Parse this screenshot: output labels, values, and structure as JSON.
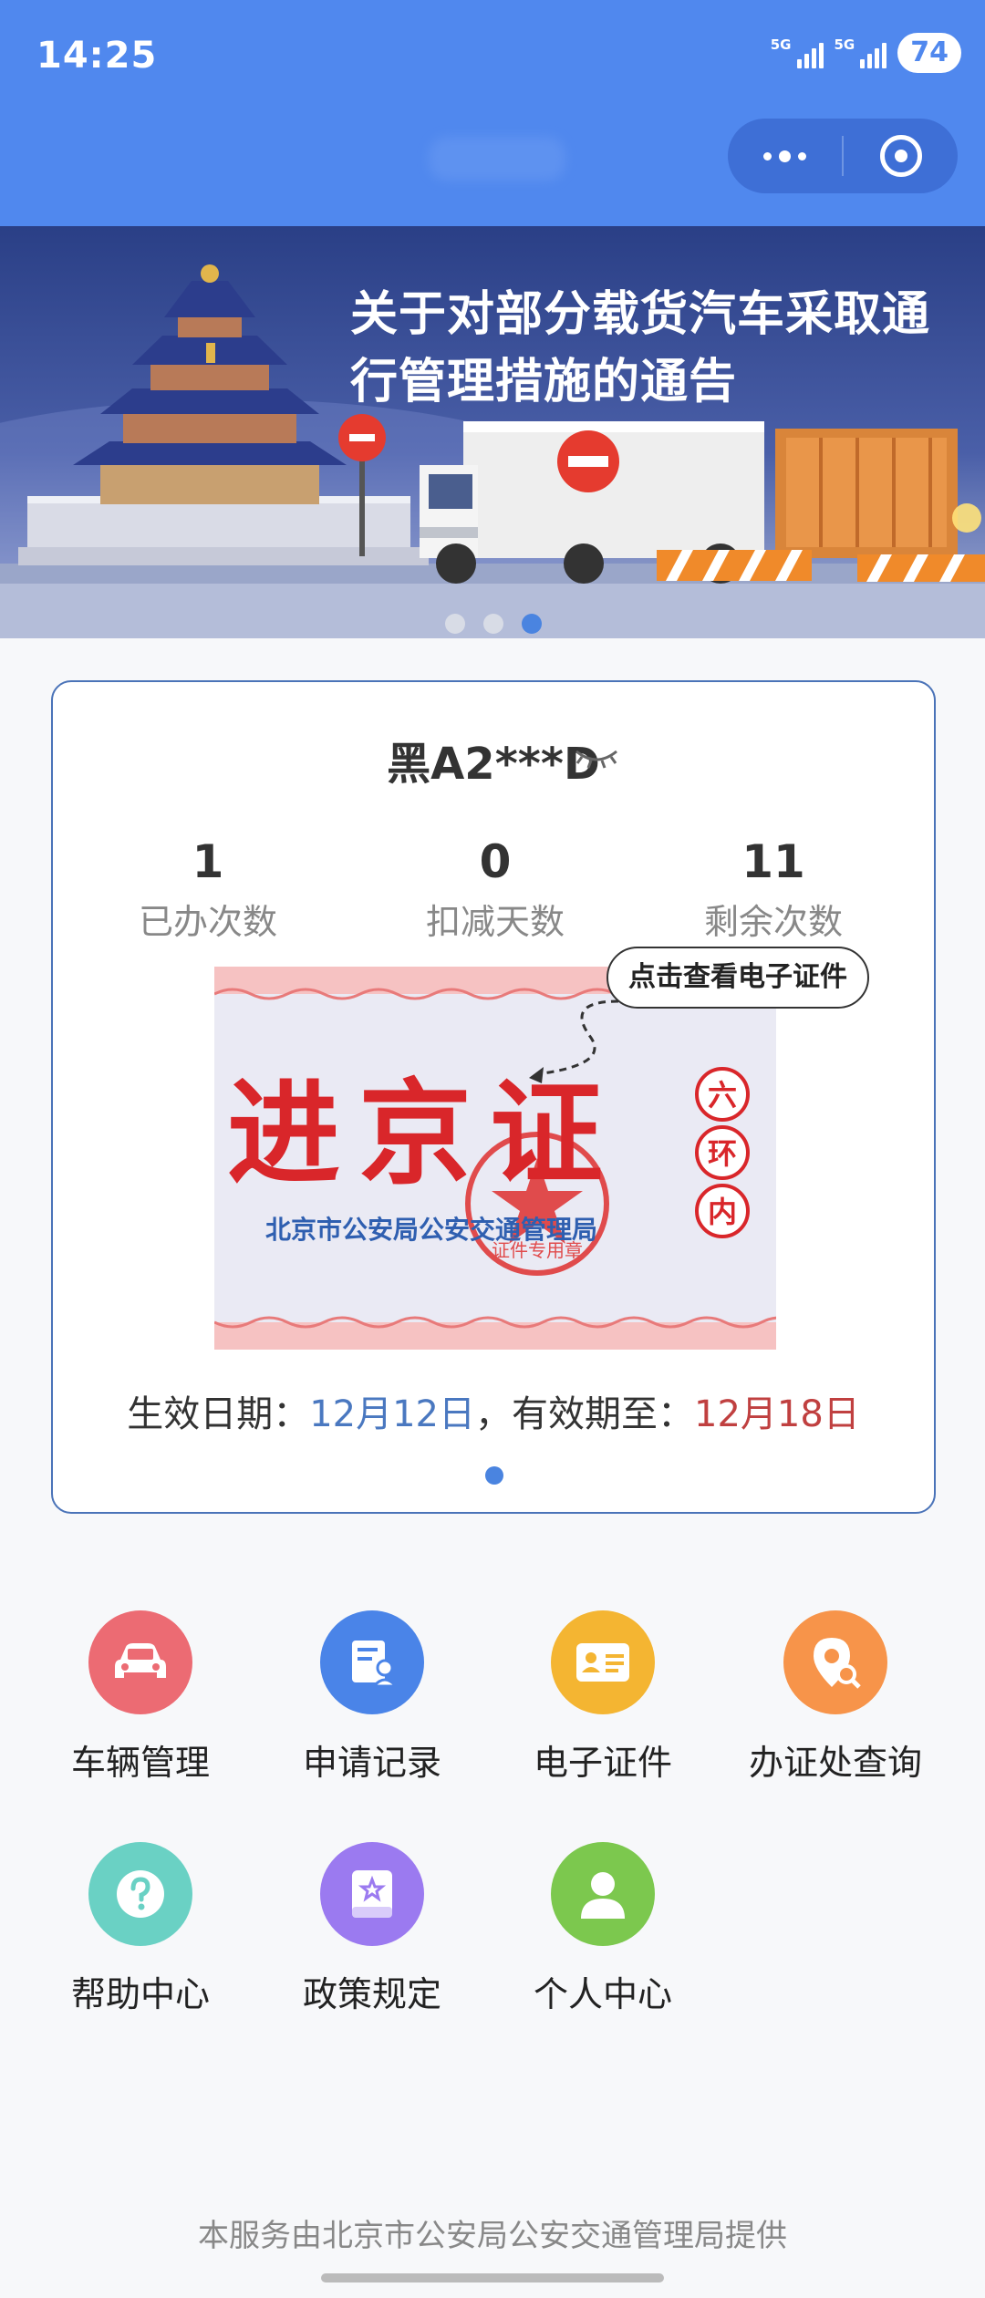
{
  "status_bar": {
    "time": "14:25",
    "signal_1": "5G",
    "signal_2": "5G",
    "battery": "74"
  },
  "banner": {
    "title": "关于对部分载货汽车采取通行管理措施的通告",
    "slide_count": 3,
    "active_slide": 3
  },
  "card": {
    "plate": "黑A2***D",
    "stats": [
      {
        "value": "1",
        "label": "已办次数"
      },
      {
        "value": "0",
        "label": "扣减天数"
      },
      {
        "value": "11",
        "label": "剩余次数"
      }
    ],
    "tip": "点击查看电子证件",
    "permit": {
      "title": "进京证",
      "zone": [
        "六",
        "环",
        "内"
      ],
      "issuer": "北京市公安局公安交通管理局",
      "seal_text": "证件专用章"
    },
    "validity_prefix": "生效日期：",
    "start_date": "12月12日",
    "validity_mid": "，有效期至：",
    "end_date": "12月18日"
  },
  "menu": [
    {
      "label": "车辆管理",
      "icon": "car-icon",
      "color": "#ec6b73"
    },
    {
      "label": "申请记录",
      "icon": "application-record-icon",
      "color": "#4a84e8"
    },
    {
      "label": "电子证件",
      "icon": "id-card-icon",
      "color": "#f4b532"
    },
    {
      "label": "办证处查询",
      "icon": "location-search-icon",
      "color": "#f7944a"
    },
    {
      "label": "帮助中心",
      "icon": "question-icon",
      "color": "#6ad1c4"
    },
    {
      "label": "政策规定",
      "icon": "policy-book-icon",
      "color": "#9b7af0"
    },
    {
      "label": "个人中心",
      "icon": "person-icon",
      "color": "#7cc84e"
    }
  ],
  "footer": "本服务由北京市公安局公安交通管理局提供",
  "colors": {
    "header": "#5088ee",
    "card_border": "#4a73b8",
    "date_blue": "#4a78c0",
    "date_red": "#c04040"
  }
}
